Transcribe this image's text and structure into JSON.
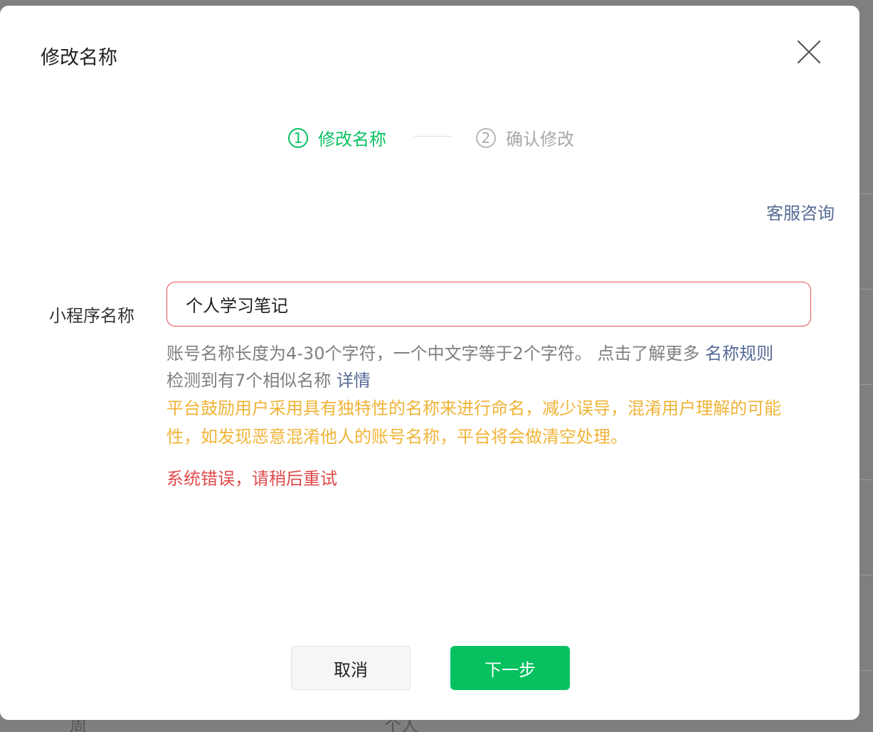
{
  "modal": {
    "title": "修改名称",
    "close_icon": "close-icon"
  },
  "steps": [
    {
      "number": "1",
      "label": "修改名称",
      "active": true
    },
    {
      "number": "2",
      "label": "确认修改",
      "active": false
    }
  ],
  "service_link": "客服咨询",
  "form": {
    "label": "小程序名称",
    "value": "个人学习笔记"
  },
  "hints": {
    "length_rule": "账号名称长度为4-30个字符，一个中文字等于2个字符。 点击了解更多",
    "rule_link": "名称规则",
    "similar_text": "检测到有7个相似名称",
    "detail_link": "详情",
    "warning": "平台鼓励用户采用具有独特性的名称来进行命名，减少误导，混淆用户理解的可能性，如发现恶意混淆他人的账号名称，平台将会做清空处理。",
    "error": "系统错误，请稍后重试"
  },
  "buttons": {
    "cancel": "取消",
    "next": "下一步"
  },
  "background": {
    "text_left": "周",
    "text_center": "个人"
  },
  "colors": {
    "accent": "#07c160",
    "link": "#576b95",
    "warning": "#f0b438",
    "error": "#e04a4a",
    "input_error_border": "#e45252"
  }
}
